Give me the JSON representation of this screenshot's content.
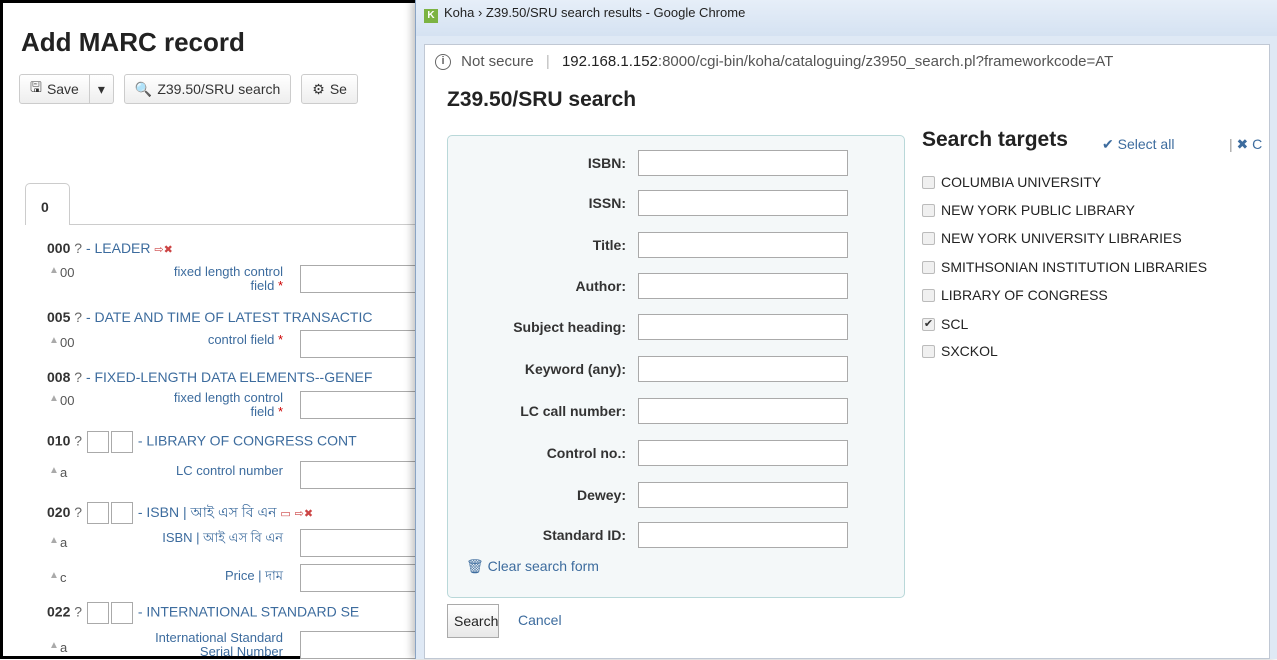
{
  "background": {
    "title": "Add MARC record",
    "toolbar": {
      "save_label": "Save",
      "z3950_label": "Z39.50/SRU search",
      "settings_label": "Se"
    },
    "tab_label": "0",
    "fields": [
      {
        "tag": "000",
        "q": "?",
        "desc": "- LEADER"
      },
      {
        "tag": "005",
        "q": "?",
        "desc": "- DATE AND TIME OF LATEST TRANSACTIC"
      },
      {
        "tag": "008",
        "q": "?",
        "desc": "- FIXED-LENGTH DATA ELEMENTS--GENEF"
      },
      {
        "tag": "010",
        "q": "?",
        "desc": "- LIBRARY OF CONGRESS CONT"
      },
      {
        "tag": "020",
        "q": "?",
        "desc": "- ISBN | আই এস বি এন"
      },
      {
        "tag": "022",
        "q": "?",
        "desc": "- INTERNATIONAL STANDARD SE"
      }
    ],
    "subfields": [
      {
        "code": "00",
        "label_line1": "fixed length control",
        "label_line2": "field",
        "required": true
      },
      {
        "code": "00",
        "label_line1": "control field",
        "label_line2": "",
        "required": true
      },
      {
        "code": "00",
        "label_line1": "fixed length control",
        "label_line2": "field",
        "required": true
      },
      {
        "code": "a",
        "label_line1": "LC control number",
        "label_line2": "",
        "required": false
      },
      {
        "code": "a",
        "label_line1": "ISBN | আই এস বি এন",
        "label_line2": "",
        "required": false
      },
      {
        "code": "c",
        "label_line1": "Price | দাম",
        "label_line2": "",
        "required": false
      },
      {
        "code": "a",
        "label_line1": "International Standard",
        "label_line2": "Serial Number",
        "required": false
      }
    ]
  },
  "popup": {
    "window_title": "Koha › Z39.50/SRU search results - Google Chrome",
    "address": {
      "security": "Not secure",
      "host": "192.168.1.152",
      "path": ":8000/cgi-bin/koha/cataloguing/z3950_search.pl?frameworkcode=AT"
    },
    "heading": "Z39.50/SRU search",
    "form_fields": [
      {
        "label": "ISBN:",
        "value": ""
      },
      {
        "label": "ISSN:",
        "value": ""
      },
      {
        "label": "Title:",
        "value": ""
      },
      {
        "label": "Author:",
        "value": ""
      },
      {
        "label": "Subject heading:",
        "value": ""
      },
      {
        "label": "Keyword (any):",
        "value": ""
      },
      {
        "label": "LC call number:",
        "value": ""
      },
      {
        "label": "Control no.:",
        "value": ""
      },
      {
        "label": "Dewey:",
        "value": ""
      },
      {
        "label": "Standard ID:",
        "value": ""
      }
    ],
    "clear_form_label": "Clear search form",
    "targets_heading": "Search targets",
    "select_all_label": "Select all",
    "clear_all_label": "C",
    "targets": [
      {
        "name": "COLUMBIA UNIVERSITY",
        "checked": false
      },
      {
        "name": "NEW YORK PUBLIC LIBRARY",
        "checked": false
      },
      {
        "name": "NEW YORK UNIVERSITY LIBRARIES",
        "checked": false
      },
      {
        "name": "SMITHSONIAN INSTITUTION LIBRARIES",
        "checked": false
      },
      {
        "name": "LIBRARY OF CONGRESS",
        "checked": false
      },
      {
        "name": "SCL",
        "checked": true
      },
      {
        "name": "SXCKOL",
        "checked": false
      }
    ],
    "search_button": "Search",
    "cancel_label": "Cancel"
  }
}
